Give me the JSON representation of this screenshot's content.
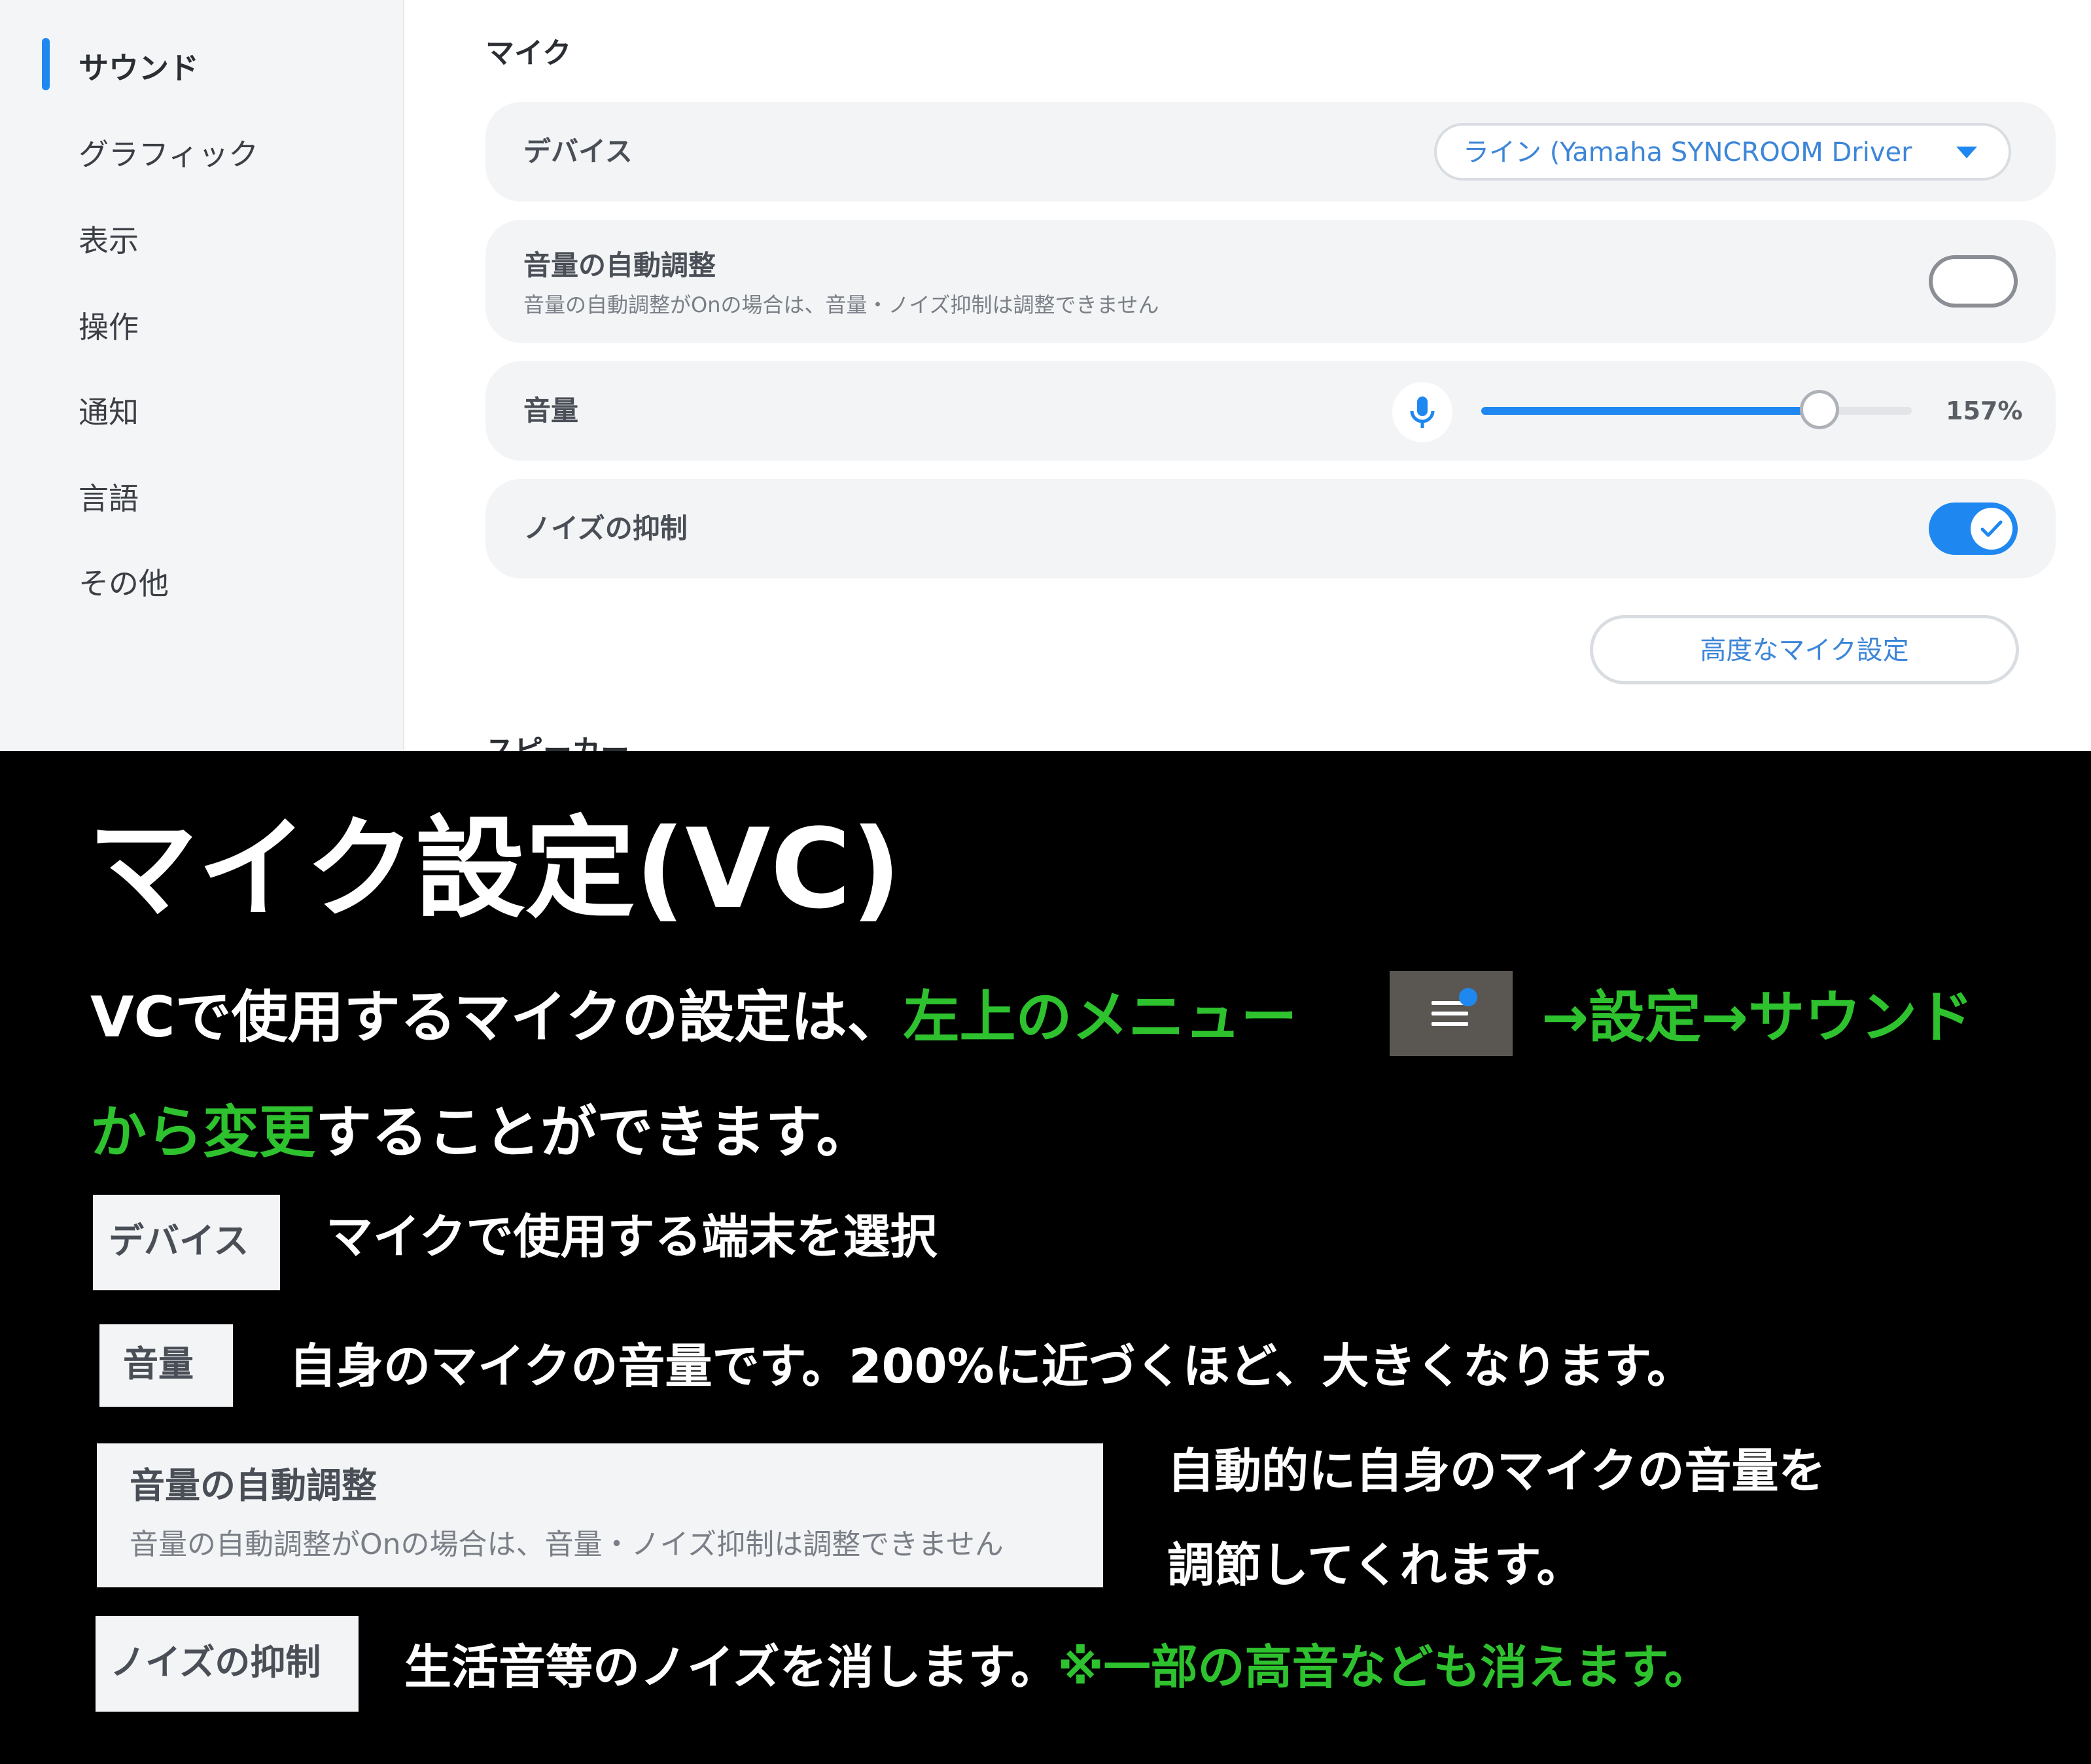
{
  "sidebar": {
    "items": [
      {
        "label": "サウンド",
        "active": true
      },
      {
        "label": "グラフィック"
      },
      {
        "label": "表示"
      },
      {
        "label": "操作"
      },
      {
        "label": "通知"
      },
      {
        "label": "言語"
      },
      {
        "label": "その他"
      }
    ]
  },
  "mic": {
    "section_title": "マイク",
    "device": {
      "label": "デバイス",
      "selected": "ライン (Yamaha SYNCROOM Driver"
    },
    "auto_volume": {
      "label": "音量の自動調整",
      "sub": "音量の自動調整がOnの場合は、音量・ノイズ抑制は調整できません",
      "on": false
    },
    "volume": {
      "label": "音量",
      "value_text": "157%",
      "value_percent": 157,
      "max_percent": 200
    },
    "noise": {
      "label": "ノイズの抑制",
      "on": true
    },
    "advanced_button": "高度なマイク設定"
  },
  "next_section_partial": "スピーカー",
  "caption": {
    "title": "マイク設定(VC)",
    "line1_white": "VCで使用するマイクの設定は、",
    "line1_green": "左上のメニュー",
    "line1_green2": "→設定→サウンド",
    "line2_green": "から変更",
    "line2_white": "することができます。",
    "items": [
      {
        "chip": "デバイス",
        "desc": "マイクで使用する端末を選択"
      },
      {
        "chip": "音量",
        "desc": "自身のマイクの音量です。200%に近づくほど、大きくなります。"
      },
      {
        "chip": "音量の自動調整",
        "chip_sub": "音量の自動調整がOnの場合は、音量・ノイズ抑制は調整できません",
        "desc_line1": "自動的に自身のマイクの音量を",
        "desc_line2": "調節してくれます。"
      },
      {
        "chip": "ノイズの抑制",
        "desc_white": "生活音等のノイズを消します。",
        "desc_green": "※一部の高音なども消えます。"
      }
    ]
  },
  "colors": {
    "accent": "#1e88f0",
    "highlight_green": "#2ec22e"
  },
  "icons": {
    "mic": "microphone-icon",
    "menu": "hamburger-menu-icon",
    "caret": "caret-down-icon",
    "check": "check-icon"
  }
}
